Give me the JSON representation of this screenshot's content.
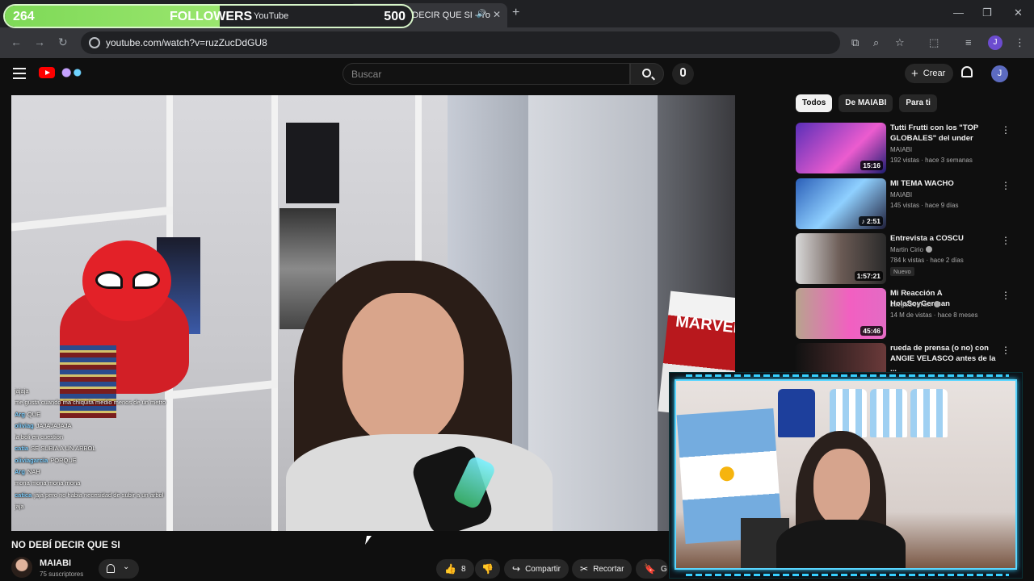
{
  "followers_widget": {
    "current": "264",
    "label": "FOLLOWERS",
    "goal": "500",
    "progress_fraction": 0.528
  },
  "browser": {
    "tabs": [
      {
        "title": "YouTube"
      },
      {
        "title": "NO DEBÍ DECIR QUE SI - Yo"
      }
    ],
    "url": "youtube.com/watch?v=ruzZucDdGU8",
    "profile_initial": "J",
    "icons": [
      "back-icon",
      "forward-icon",
      "reload-icon",
      "site-info-icon",
      "install-app-icon",
      "zoom-icon",
      "bookmark-star-icon",
      "extensions-icon",
      "tab-search-icon",
      "menu-dots-icon",
      "minimize-icon",
      "maximize-icon",
      "close-icon",
      "new-tab-icon",
      "speaker-icon"
    ]
  },
  "youtube_header": {
    "search_placeholder": "Buscar",
    "create_label": "Crear",
    "avatar_initial": "J"
  },
  "chips": [
    "Todos",
    "De MAIABI",
    "Para ti"
  ],
  "recommendations": [
    {
      "title": "Tutti Frutti con los \"TOP GLOBALES\" del under",
      "channel": "MAIABI",
      "meta": "192 vistas · hace 3 semanas",
      "duration": "15:16",
      "verified": false,
      "badge": ""
    },
    {
      "title": "MI TEMA WACHO",
      "channel": "MAIABI",
      "meta": "145 vistas · hace 9 días",
      "duration": "♪ 2:51",
      "verified": false,
      "badge": ""
    },
    {
      "title": "Entrevista a COSCU",
      "channel": "Martin Cirio",
      "meta": "784 k vistas · hace 2 días",
      "duration": "1:57:21",
      "verified": true,
      "badge": "Nuevo"
    },
    {
      "title": "Mi Reacción A HolaSoyGerman",
      "channel": "JuegaGerman",
      "meta": "14 M de vistas · hace 8 meses",
      "duration": "45:46",
      "verified": true,
      "badge": ""
    },
    {
      "title": "rueda de prensa (o no) con ANGIE VELASCO antes de la ...",
      "channel": "",
      "meta": "",
      "duration": "",
      "verified": false,
      "badge": ""
    }
  ],
  "chat": [
    {
      "user": "",
      "text": "jajaja",
      "highlight": false
    },
    {
      "user": "",
      "text": "me gusta cuando ma chiquita  medio menos de un metro",
      "highlight": true
    },
    {
      "user": "Arg",
      "text": "QUE",
      "highlight": false
    },
    {
      "user": "oliviag",
      "text": "JAJAJAJAJA",
      "highlight": false
    },
    {
      "user": "",
      "text": "la boli en cuestion",
      "highlight": false
    },
    {
      "user": "catia",
      "text": "SE SUBIA A UN ARBOL",
      "highlight": false
    },
    {
      "user": "oliviagarcia",
      "text": "PORQUE",
      "highlight": false
    },
    {
      "user": "Arg",
      "text": "NAH",
      "highlight": false
    },
    {
      "user": "",
      "text": "mona mona mona mona",
      "highlight": false
    },
    {
      "user": "catica",
      "text": "jaja pero no habia necesidad de subir a un arbol",
      "highlight": false
    },
    {
      "user": "",
      "text": "jaja",
      "highlight": false
    }
  ],
  "video": {
    "title": "NO DEBÍ DECIR QUE SI",
    "channel": "MAIABI",
    "subscribers": "75 suscriptores",
    "likes": "8",
    "share_label": "Compartir",
    "clip_label": "Recortar",
    "save_label": "G",
    "poster_text": "MARVEL"
  }
}
